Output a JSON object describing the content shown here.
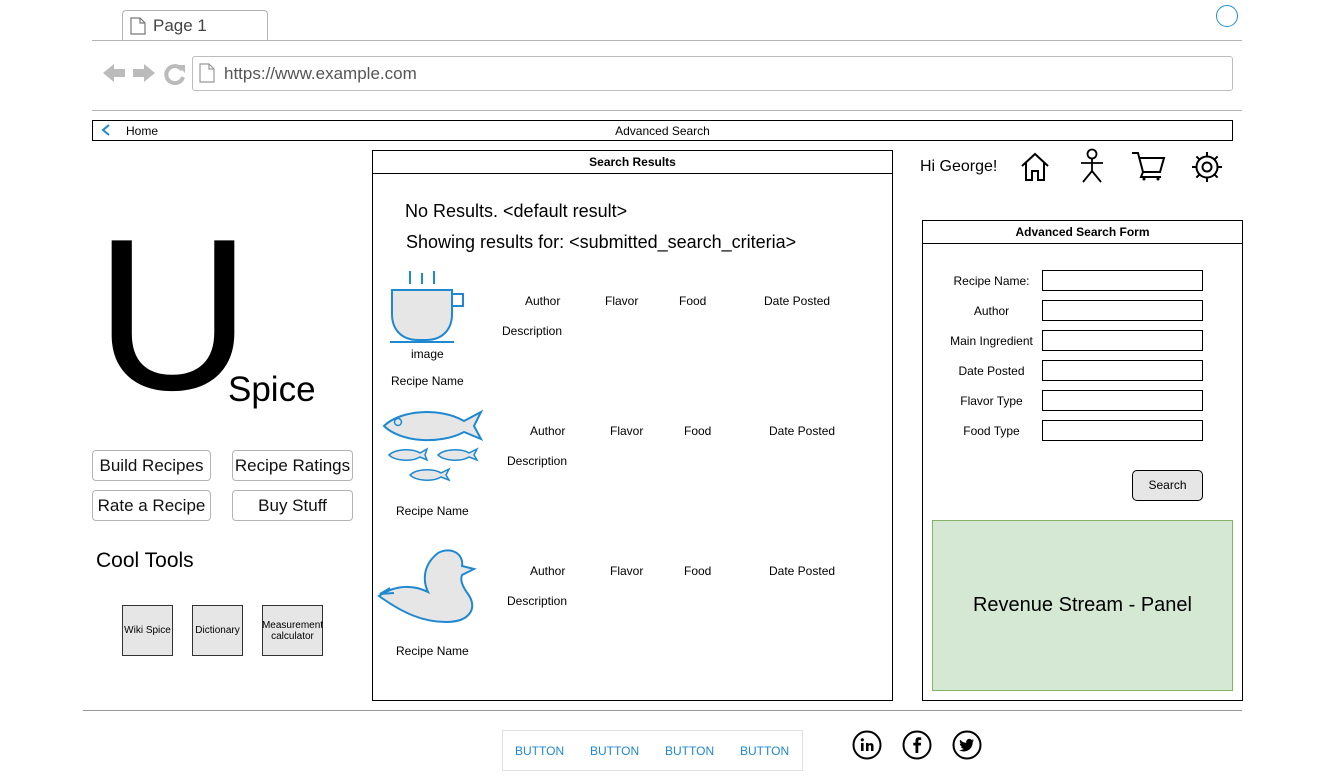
{
  "browser": {
    "tab_title": "Page 1",
    "url": "https://www.example.com"
  },
  "breadcrumb": {
    "home_label": "Home",
    "title": "Advanced Search"
  },
  "logo": {
    "letter": "U",
    "word": "Spice"
  },
  "nav_buttons": [
    "Build Recipes",
    "Recipe Ratings",
    "Rate a Recipe",
    "Buy Stuff"
  ],
  "cool_tools": {
    "title": "Cool Tools",
    "items": [
      "Wiki Spice",
      "Dictionary",
      "Measurement calculator"
    ]
  },
  "results": {
    "title": "Search Results",
    "no_results": "No Results. <default result>",
    "showing_for": "Showing results for: <submitted_search_criteria>",
    "items": [
      {
        "icon": "coffee-cup-icon",
        "image_label": "image",
        "name": "Recipe Name",
        "author": "Author",
        "flavor": "Flavor",
        "food": "Food",
        "date": "Date Posted",
        "description": "Description"
      },
      {
        "icon": "fish-icon",
        "name": "Recipe Name",
        "author": "Author",
        "flavor": "Flavor",
        "food": "Food",
        "date": "Date Posted",
        "description": "Description"
      },
      {
        "icon": "duck-icon",
        "name": "Recipe Name",
        "author": "Author",
        "flavor": "Flavor",
        "food": "Food",
        "date": "Date Posted",
        "description": "Description"
      }
    ]
  },
  "header": {
    "greeting": "Hi George!",
    "icons": [
      "home-icon",
      "user-icon",
      "cart-icon",
      "settings-icon"
    ]
  },
  "search_form": {
    "title": "Advanced Search Form",
    "fields": [
      {
        "label": "Recipe Name:",
        "value": ""
      },
      {
        "label": "Author",
        "value": ""
      },
      {
        "label": "Main Ingredient",
        "value": ""
      },
      {
        "label": "Date Posted",
        "value": ""
      },
      {
        "label": "Flavor Type",
        "value": ""
      },
      {
        "label": "Food Type",
        "value": ""
      }
    ],
    "submit_label": "Search"
  },
  "revenue_panel": "Revenue Stream - Panel",
  "footer": {
    "buttons": [
      "BUTTON",
      "BUTTON",
      "BUTTON",
      "BUTTON"
    ],
    "social": [
      "linkedin-icon",
      "facebook-icon",
      "twitter-icon"
    ]
  },
  "colors": {
    "accent": "#1e88d0",
    "icon_fill": "#e6e6e6",
    "revenue_bg": "#d5e8d4"
  }
}
